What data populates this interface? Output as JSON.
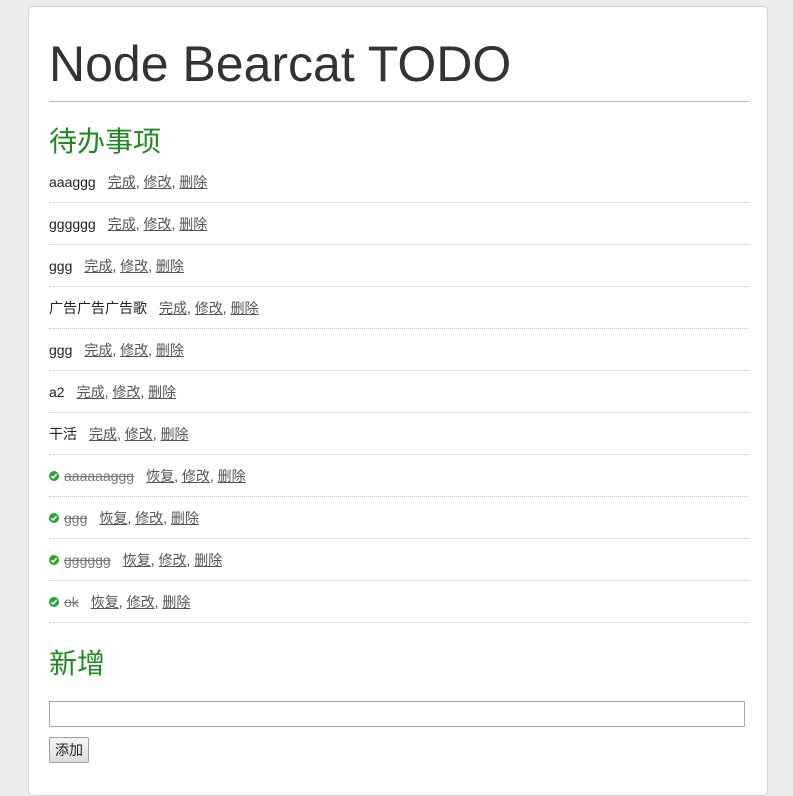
{
  "header": {
    "title": "Node Bearcat TODO"
  },
  "pending": {
    "heading": "待办事项",
    "items": [
      {
        "text": "aaaggg",
        "done": false,
        "primary_action": "完成"
      },
      {
        "text": "gggggg",
        "done": false,
        "primary_action": "完成"
      },
      {
        "text": "ggg",
        "done": false,
        "primary_action": "完成"
      },
      {
        "text": "广告广告广告歌",
        "done": false,
        "primary_action": "完成"
      },
      {
        "text": "ggg",
        "done": false,
        "primary_action": "完成"
      },
      {
        "text": "a2",
        "done": false,
        "primary_action": "完成"
      },
      {
        "text": "干活",
        "done": false,
        "primary_action": "完成"
      },
      {
        "text": "aaaaaaggg",
        "done": true,
        "primary_action": "恢复"
      },
      {
        "text": "ggg",
        "done": true,
        "primary_action": "恢复"
      },
      {
        "text": "gggggg",
        "done": true,
        "primary_action": "恢复"
      },
      {
        "text": "ok",
        "done": true,
        "primary_action": "恢复"
      }
    ],
    "edit_label": "修改",
    "delete_label": "删除",
    "separator": ", "
  },
  "add": {
    "heading": "新增",
    "input_value": "",
    "button_label": "添加"
  },
  "colors": {
    "heading": "#1f8a1f",
    "check": "#2aa52a",
    "background": "#ececec"
  },
  "icons": {
    "done": "check-circle-icon"
  }
}
